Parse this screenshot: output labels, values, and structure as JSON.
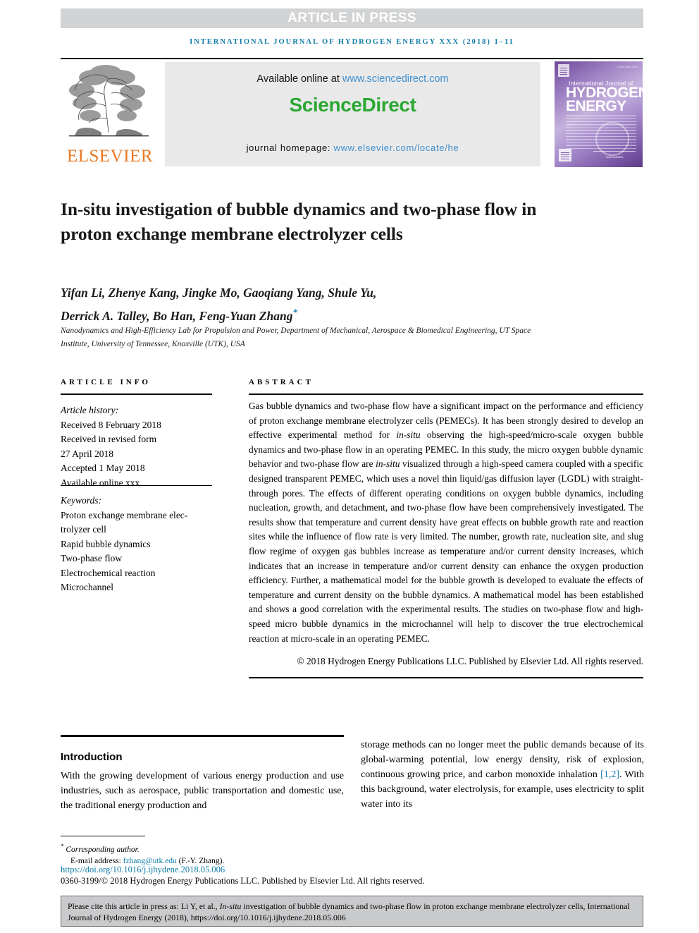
{
  "banner": {
    "article_in_press": "ARTICLE IN PRESS",
    "running_head": "international journal of hydrogen energy xxx (2018) 1–11"
  },
  "masthead": {
    "publisher": "ELSEVIER",
    "available_prefix": "Available online at ",
    "available_link": "www.sciencedirect.com",
    "sciencedirect_logo": "ScienceDirect",
    "homepage_prefix": "journal homepage: ",
    "homepage_link": "www.elsevier.com/locate/he",
    "cover": {
      "issn": "ISSN 0360-3199",
      "line1": "International Journal of",
      "line2": "HYDROGEN",
      "line3": "ENERGY",
      "foot": "ScienceDirect"
    }
  },
  "article": {
    "title": "In-situ investigation of bubble dynamics and two-phase flow in proton exchange membrane electrolyzer cells",
    "authors_line1": "Yifan Li, Zhenye Kang, Jingke Mo, Gaoqiang Yang, Shule Yu,",
    "authors_line2": "Derrick A. Talley, Bo Han, Feng-Yuan Zhang",
    "corresponding_marker": "*",
    "affiliation": "Nanodynamics and High-Efficiency Lab for Propulsion and Power, Department of Mechanical, Aerospace & Biomedical Engineering, UT Space Institute, University of Tennessee, Knoxville (UTK), USA"
  },
  "article_info": {
    "heading": "ARTICLE INFO",
    "history_label": "Article history:",
    "history": [
      "Received 8 February 2018",
      "Received in revised form",
      "27 April 2018",
      "Accepted 1 May 2018",
      "Available online xxx"
    ],
    "keywords_label": "Keywords:",
    "keywords": [
      "Proton exchange membrane elec-trolyzer cell",
      "Rapid bubble dynamics",
      "Two-phase flow",
      "Electrochemical reaction",
      "Microchannel"
    ]
  },
  "abstract": {
    "heading": "ABSTRACT",
    "p1": "Gas bubble dynamics and two-phase flow have a significant impact on the performance and efficiency of proton exchange membrane electrolyzer cells (PEMECs). It has been strongly desired to develop an effective experimental method for ",
    "em1": "in-situ",
    "p2": " observing the high-speed/micro-scale oxygen bubble dynamics and two-phase flow in an operating PEMEC. In this study, the micro oxygen bubble dynamic behavior and two-phase flow are ",
    "em2": "in-situ",
    "p3": " visualized through a high-speed camera coupled with a specific designed transparent PEMEC, which uses a novel thin liquid/gas diffusion layer (LGDL) with straight-through pores. The effects of different operating conditions on oxygen bubble dynamics, including nucleation, growth, and detachment, and two-phase flow have been comprehensively investigated. The results show that temperature and current density have great effects on bubble growth rate and reaction sites while the influence of flow rate is very limited. The number, growth rate, nucleation site, and slug flow regime of oxygen gas bubbles increase as temperature and/or current density increases, which indicates that an increase in temperature and/or current density can enhance the oxygen production efficiency. Further, a mathematical model for the bubble growth is developed to evaluate the effects of temperature and current density on the bubble dynamics. A mathematical model has been established and shows a good correlation with the experimental results. The studies on two-phase flow and high-speed micro bubble dynamics in the microchannel will help to discover the true electrochemical reaction at micro-scale in an operating PEMEC.",
    "copyright": "© 2018 Hydrogen Energy Publications LLC. Published by Elsevier Ltd. All rights reserved."
  },
  "body": {
    "section_title": "Introduction",
    "left_text": "With the growing development of various energy production and use industries, such as aerospace, public transportation and domestic use, the traditional energy production and",
    "right_text_a": "storage methods can no longer meet the public demands because of its global-warming potential, low energy density, risk of explosion, continuous growing price, and carbon monoxide inhalation ",
    "right_ref": "[1,2]",
    "right_text_b": ". With this background, water electrolysis, for example, uses electricity to split water into its"
  },
  "footer": {
    "corresponding_marker": "*",
    "corresponding_label": "Corresponding author.",
    "email_label": "E-mail address: ",
    "email": "fzhang@utk.edu",
    "email_suffix": " (F.-Y. Zhang).",
    "doi": "https://doi.org/10.1016/j.ijhydene.2018.05.006",
    "issn_copyright": "0360-3199/© 2018 Hydrogen Energy Publications LLC. Published by Elsevier Ltd. All rights reserved."
  },
  "citation_box": {
    "prefix": "Please cite this article in press as: Li Y, et al., ",
    "em": "In-situ",
    "suffix": " investigation of bubble dynamics and two-phase flow in proton exchange membrane electrolyzer cells, International Journal of Hydrogen Energy (2018), https://doi.org/10.1016/j.ijhydene.2018.05.006"
  },
  "colors": {
    "journal_blue": "#0f7ba8",
    "sciencedirect_green": "#2aa832",
    "elsevier_orange": "#e87722",
    "link_blue": "#3f8fd0",
    "banner_gray": "#d1d3d4",
    "cite_box_gray": "#c9cacc"
  }
}
